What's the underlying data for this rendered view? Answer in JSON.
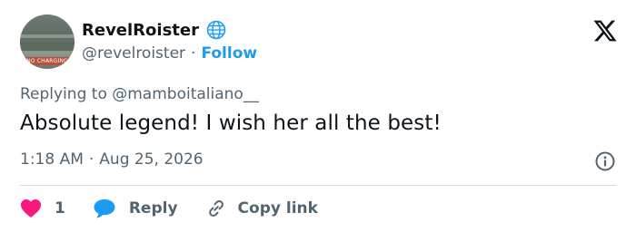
{
  "author": {
    "name": "RevelRoister",
    "handle": "@revelroister",
    "separator": "·",
    "follow_label": "Follow",
    "avatar_sign_text": "NO CHARGING"
  },
  "icons": {
    "verified": "globe-icon",
    "platform": "x-logo-icon",
    "info": "info-icon",
    "like": "heart-icon",
    "reply": "speech-bubble-icon",
    "copy": "link-icon"
  },
  "tweet": {
    "replying_to_prefix": "Replying to",
    "replying_to_handle": "@mamboitaliano__",
    "text": "Absolute legend! I wish her all the best!",
    "time": "1:18 AM",
    "meta_separator": "·",
    "date": "Aug 25, 2026"
  },
  "actions": {
    "like_count": "1",
    "reply_label": "Reply",
    "copy_label": "Copy link"
  },
  "colors": {
    "accent": "#1d9bf0",
    "like": "#f91880",
    "muted": "#536471",
    "text": "#0f1419",
    "divider": "#cfd9de"
  }
}
